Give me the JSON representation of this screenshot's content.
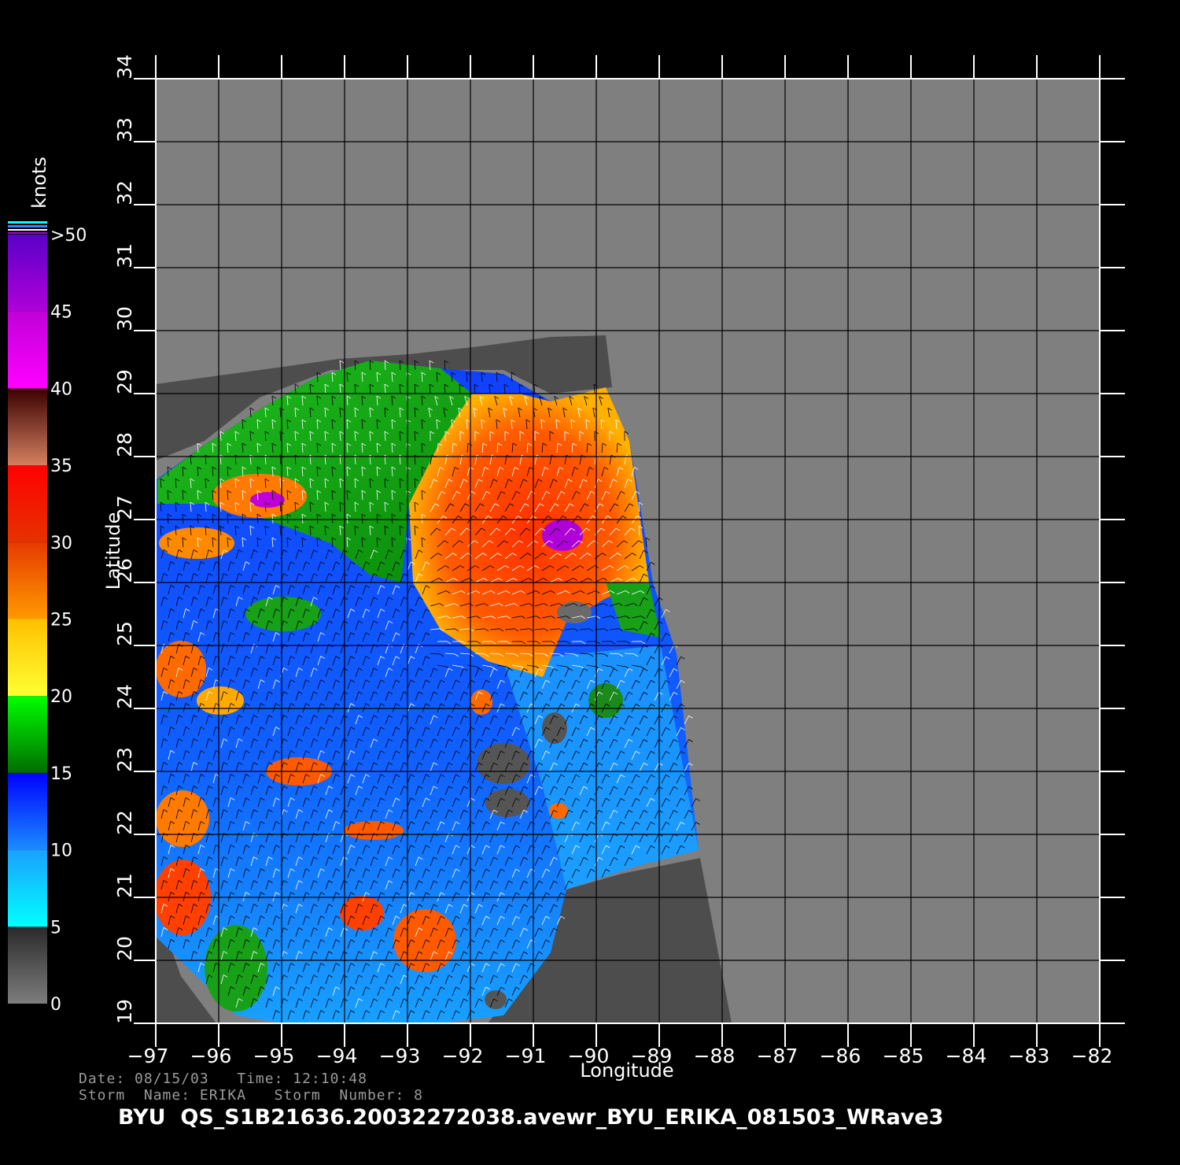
{
  "map": {
    "xaxis": {
      "title": "Longitude",
      "range": [
        -97,
        -82
      ],
      "ticks": [
        "−97",
        "−96",
        "−95",
        "−94",
        "−93",
        "−92",
        "−91",
        "−90",
        "−89",
        "−88",
        "−87",
        "−86",
        "−85",
        "−84",
        "−83",
        "−82"
      ]
    },
    "yaxis": {
      "title": "Latitude",
      "range": [
        19,
        34
      ],
      "ticks": [
        "19",
        "20",
        "21",
        "22",
        "23",
        "24",
        "25",
        "26",
        "27",
        "28",
        "29",
        "30",
        "31",
        "32",
        "33",
        "34"
      ]
    },
    "grid": true,
    "background_color": "#7f7f7f",
    "land_color": "#4d4d4d"
  },
  "colorbar": {
    "unit": "knots",
    "labels": [
      "0",
      "5",
      "10",
      "15",
      "20",
      "25",
      "30",
      "35",
      "40",
      "45",
      ">50"
    ],
    "bands": [
      {
        "min": 0,
        "max": 5,
        "from": "#7d7d7d",
        "to": "#2a2a2a"
      },
      {
        "min": 5,
        "max": 10,
        "from": "#00ffff",
        "to": "#1aa0ff"
      },
      {
        "min": 10,
        "max": 15,
        "from": "#1a8cff",
        "to": "#0000ff"
      },
      {
        "min": 15,
        "max": 20,
        "from": "#006d00",
        "to": "#00ff00"
      },
      {
        "min": 20,
        "max": 25,
        "from": "#ffff33",
        "to": "#ffc000"
      },
      {
        "min": 25,
        "max": 30,
        "from": "#ff9a00",
        "to": "#e63a00"
      },
      {
        "min": 30,
        "max": 35,
        "from": "#e63200",
        "to": "#ff0000"
      },
      {
        "min": 35,
        "max": 40,
        "from": "#d48060",
        "to": "#3a0000"
      },
      {
        "min": 40,
        "max": 45,
        "from": "#ff00ff",
        "to": "#c000d8"
      },
      {
        "min": 45,
        "max": 50,
        "from": "#b000d8",
        "to": "#5a00c8"
      }
    ]
  },
  "footer": {
    "date_time": "Date: 08/15/03   Time: 12:10:48",
    "storm": "Storm  Name: ERIKA   Storm  Number: 8",
    "product": "BYU  QS_S1B21636.20032272038.avewr_BYU_ERIKA_081503_WRave3"
  }
}
